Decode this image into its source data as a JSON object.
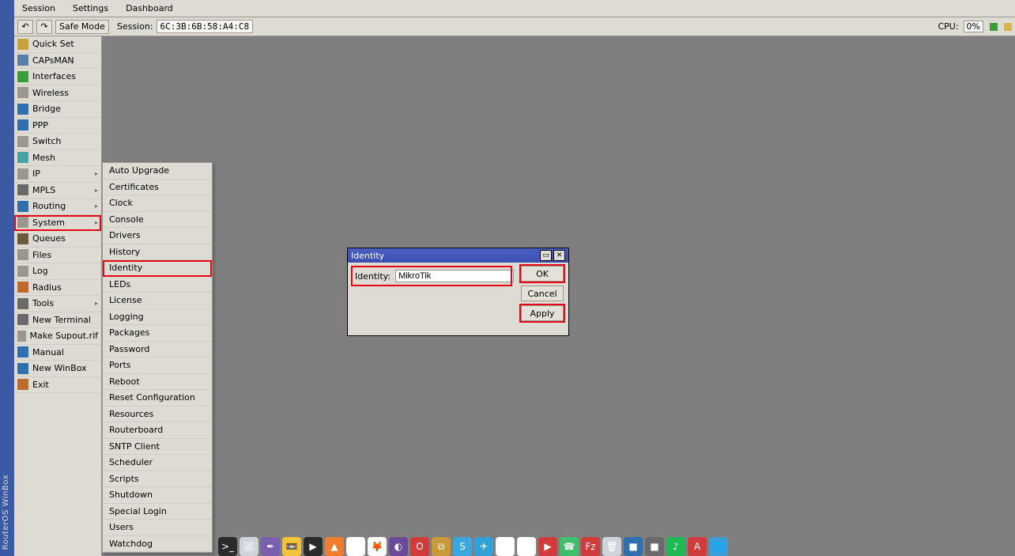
{
  "brand_vertical": "RouterOS WinBox",
  "menubar": [
    "Session",
    "Settings",
    "Dashboard"
  ],
  "toolbar": {
    "undo_glyph": "↶",
    "redo_glyph": "↷",
    "safe_mode": "Safe Mode",
    "session_label": "Session:",
    "session_value": "6C:3B:6B:58:A4:C8",
    "cpu_label": "CPU:",
    "cpu_value": "0%"
  },
  "sidebar": [
    {
      "label": "Quick Set",
      "icon": "i-a",
      "arrow": false
    },
    {
      "label": "CAPsMAN",
      "icon": "i-b",
      "arrow": false
    },
    {
      "label": "Interfaces",
      "icon": "i-c",
      "arrow": false
    },
    {
      "label": "Wireless",
      "icon": "i-d",
      "arrow": false
    },
    {
      "label": "Bridge",
      "icon": "i-e",
      "arrow": false
    },
    {
      "label": "PPP",
      "icon": "i-e",
      "arrow": false
    },
    {
      "label": "Switch",
      "icon": "i-d",
      "arrow": false
    },
    {
      "label": "Mesh",
      "icon": "i-h",
      "arrow": false
    },
    {
      "label": "IP",
      "icon": "i-d",
      "arrow": true
    },
    {
      "label": "MPLS",
      "icon": "i-i",
      "arrow": true
    },
    {
      "label": "Routing",
      "icon": "i-e",
      "arrow": true
    },
    {
      "label": "System",
      "icon": "i-d",
      "arrow": true,
      "hl": true
    },
    {
      "label": "Queues",
      "icon": "i-f",
      "arrow": false
    },
    {
      "label": "Files",
      "icon": "i-d",
      "arrow": false
    },
    {
      "label": "Log",
      "icon": "i-d",
      "arrow": false
    },
    {
      "label": "Radius",
      "icon": "i-g",
      "arrow": false
    },
    {
      "label": "Tools",
      "icon": "i-i",
      "arrow": true
    },
    {
      "label": "New Terminal",
      "icon": "i-i",
      "arrow": false
    },
    {
      "label": "Make Supout.rif",
      "icon": "i-d",
      "arrow": false
    },
    {
      "label": "Manual",
      "icon": "i-e",
      "arrow": false
    },
    {
      "label": "New WinBox",
      "icon": "i-e",
      "arrow": false
    },
    {
      "label": "Exit",
      "icon": "i-g",
      "arrow": false
    }
  ],
  "submenu": [
    "Auto Upgrade",
    "Certificates",
    "Clock",
    "Console",
    "Drivers",
    "History",
    "Identity",
    "LEDs",
    "License",
    "Logging",
    "Packages",
    "Password",
    "Ports",
    "Reboot",
    "Reset Configuration",
    "Resources",
    "Routerboard",
    "SNTP Client",
    "Scheduler",
    "Scripts",
    "Shutdown",
    "Special Login",
    "Users",
    "Watchdog"
  ],
  "submenu_hl_index": 6,
  "dialog": {
    "title": "Identity",
    "field_label": "Identity:",
    "field_value": "MikroTik",
    "ok": "OK",
    "cancel": "Cancel",
    "apply": "Apply"
  },
  "dock": [
    {
      "name": "terminal",
      "bg": "#2b2b2b",
      "glyph": ">_"
    },
    {
      "name": "image-viewer",
      "bg": "#cfd4da",
      "glyph": "🖼"
    },
    {
      "name": "feather",
      "bg": "#7a5fb0",
      "glyph": "✒"
    },
    {
      "name": "cassette",
      "bg": "#f5c33b",
      "glyph": "📼"
    },
    {
      "name": "plex",
      "bg": "#2b2b2b",
      "glyph": "▶"
    },
    {
      "name": "vlc",
      "bg": "#f07d2f",
      "glyph": "▲"
    },
    {
      "name": "chrome",
      "bg": "#ffffff",
      "glyph": "◉"
    },
    {
      "name": "firefox",
      "bg": "#ffffff",
      "glyph": "🦊"
    },
    {
      "name": "tor",
      "bg": "#6a4a9a",
      "glyph": "◐"
    },
    {
      "name": "opera",
      "bg": "#d13b3b",
      "glyph": "O"
    },
    {
      "name": "virtualbox",
      "bg": "#c99a3a",
      "glyph": "⧉"
    },
    {
      "name": "skype",
      "bg": "#3aa7e0",
      "glyph": "S"
    },
    {
      "name": "telegram",
      "bg": "#2fa0d8",
      "glyph": "✈"
    },
    {
      "name": "gmail",
      "bg": "#ffffff",
      "glyph": "✉"
    },
    {
      "name": "drive",
      "bg": "#ffffff",
      "glyph": "▲"
    },
    {
      "name": "youtube",
      "bg": "#d13b3b",
      "glyph": "▶"
    },
    {
      "name": "whatsapp",
      "bg": "#3fbf6a",
      "glyph": "☎"
    },
    {
      "name": "filezilla",
      "bg": "#d13b3b",
      "glyph": "Fz"
    },
    {
      "name": "trash",
      "bg": "#cfd4da",
      "glyph": "🗑"
    },
    {
      "name": "app-blue",
      "bg": "#2f6fae",
      "glyph": "■"
    },
    {
      "name": "app-gray",
      "bg": "#6a6a6a",
      "glyph": "■"
    },
    {
      "name": "spotify",
      "bg": "#1db954",
      "glyph": "♪"
    },
    {
      "name": "pdf",
      "bg": "#d13b3b",
      "glyph": "A"
    },
    {
      "name": "globe",
      "bg": "#3a9dd8",
      "glyph": "🌐"
    }
  ]
}
